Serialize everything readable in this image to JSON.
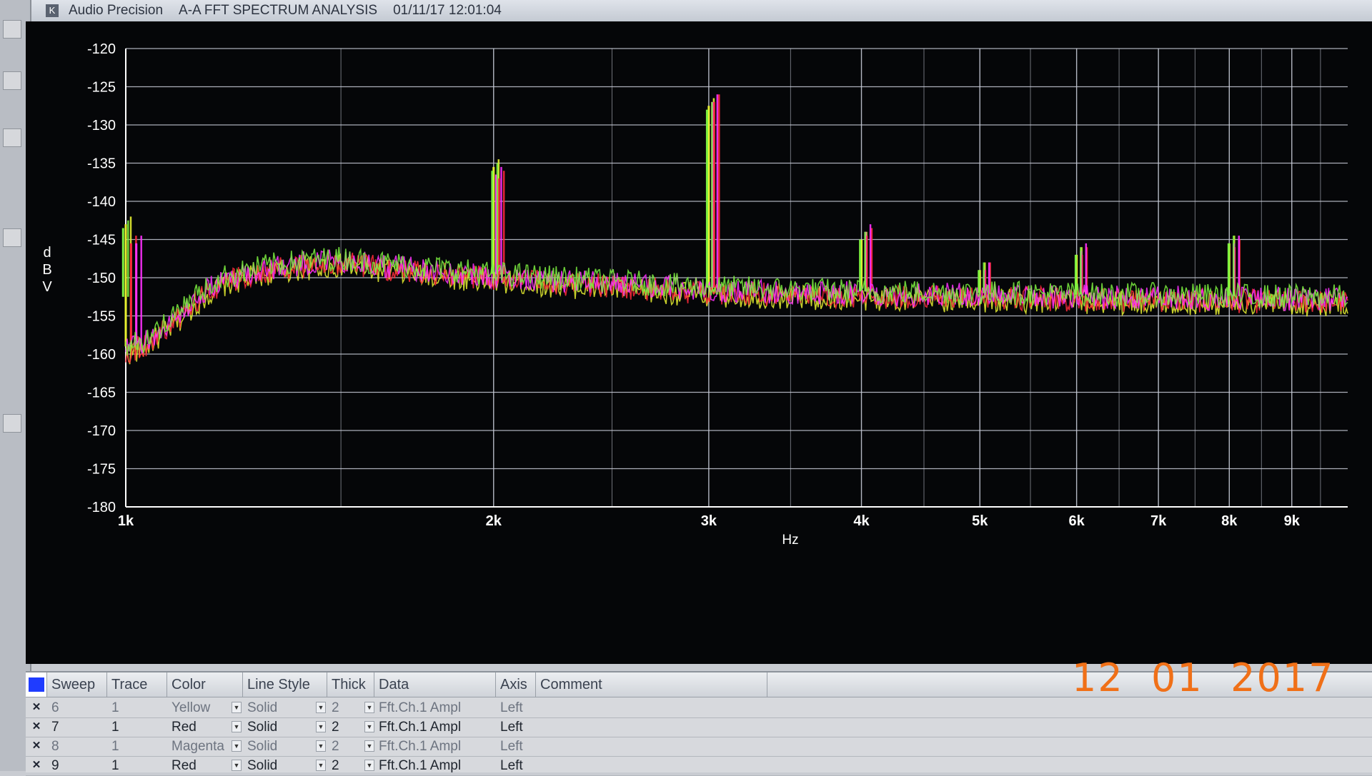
{
  "window": {
    "app_name": "Audio Precision",
    "graph_title": "A-A FFT SPECTRUM ANALYSIS",
    "timestamp": "01/11/17 12:01:04",
    "app_icon": "audio-precision-logo-icon"
  },
  "chart_data": {
    "type": "line",
    "ylabel": "d\nB\nV",
    "xlabel": "Hz",
    "xscale": "log",
    "xlim": [
      1000,
      10000
    ],
    "ylim": [
      -180,
      -120
    ],
    "y_ticks": [
      -120,
      -125,
      -130,
      -135,
      -140,
      -145,
      -150,
      -155,
      -160,
      -165,
      -170,
      -175,
      -180
    ],
    "x_ticks": [
      {
        "value": 1000,
        "label": "1k"
      },
      {
        "value": 2000,
        "label": "2k"
      },
      {
        "value": 3000,
        "label": "3k"
      },
      {
        "value": 4000,
        "label": "4k"
      },
      {
        "value": 5000,
        "label": "5k"
      },
      {
        "value": 6000,
        "label": "6k"
      },
      {
        "value": 7000,
        "label": "7k"
      },
      {
        "value": 8000,
        "label": "8k"
      },
      {
        "value": 9000,
        "label": "9k"
      }
    ],
    "grid": true,
    "background": "#050608",
    "noise_floor": {
      "x": [
        1000,
        1030,
        1060,
        1100,
        1150,
        1200,
        1300,
        1400,
        1500,
        1600,
        1800,
        2000,
        2500,
        3000,
        4000,
        5000,
        6000,
        7000,
        8000,
        9000,
        10000
      ],
      "y": [
        -160,
        -159.5,
        -158,
        -156,
        -153,
        -151,
        -149.5,
        -148.8,
        -148.5,
        -149,
        -149.8,
        -150.5,
        -151.5,
        -152.3,
        -152.8,
        -153,
        -153.2,
        -153.3,
        -153.4,
        -153.5,
        -153.5
      ]
    },
    "series": [
      {
        "name": "Yellow",
        "color": "#e8f030",
        "peaks": [
          {
            "x": 1000,
            "y": -143
          },
          {
            "x": 2000,
            "y": -135.5
          },
          {
            "x": 3000,
            "y": -127.5
          },
          {
            "x": 4000,
            "y": -145
          },
          {
            "x": 5000,
            "y": -149
          },
          {
            "x": 6000,
            "y": -147
          },
          {
            "x": 8000,
            "y": -145.5
          }
        ]
      },
      {
        "name": "Red",
        "color": "#ff2a3a",
        "peaks": [
          {
            "x": 1010,
            "y": -145.5
          },
          {
            "x": 2020,
            "y": -137
          },
          {
            "x": 3030,
            "y": -127
          },
          {
            "x": 4040,
            "y": -144.5
          },
          {
            "x": 5050,
            "y": -149
          },
          {
            "x": 6060,
            "y": -147
          },
          {
            "x": 8080,
            "y": -146
          }
        ]
      },
      {
        "name": "Magenta",
        "color": "#ff30ff",
        "peaks": [
          {
            "x": 1020,
            "y": -145.5
          },
          {
            "x": 2010,
            "y": -136.5
          },
          {
            "x": 3020,
            "y": -127
          },
          {
            "x": 4030,
            "y": -144
          },
          {
            "x": 5040,
            "y": -149
          },
          {
            "x": 6050,
            "y": -146.5
          },
          {
            "x": 8070,
            "y": -145.5
          }
        ]
      },
      {
        "name": "Green",
        "color": "#7cf040",
        "peaks": [
          {
            "x": 995,
            "y": -143.5
          },
          {
            "x": 1995,
            "y": -136
          },
          {
            "x": 2990,
            "y": -128
          },
          {
            "x": 3990,
            "y": -145
          },
          {
            "x": 4990,
            "y": -149
          },
          {
            "x": 5990,
            "y": -147
          },
          {
            "x": 7990,
            "y": -145.5
          }
        ]
      }
    ]
  },
  "legend": {
    "columns": [
      "Sweep",
      "Trace",
      "Color",
      "Line Style",
      "Thick",
      "Data",
      "Axis",
      "Comment"
    ],
    "rows": [
      {
        "sweep": "6",
        "trace": "1",
        "color": "Yellow",
        "line_style": "Solid",
        "thick": "2",
        "data": "Fft.Ch.1 Ampl",
        "axis": "Left",
        "comment": "",
        "strong": false
      },
      {
        "sweep": "7",
        "trace": "1",
        "color": "Red",
        "line_style": "Solid",
        "thick": "2",
        "data": "Fft.Ch.1 Ampl",
        "axis": "Left",
        "comment": "",
        "strong": true
      },
      {
        "sweep": "8",
        "trace": "1",
        "color": "Magenta",
        "line_style": "Solid",
        "thick": "2",
        "data": "Fft.Ch.1 Ampl",
        "axis": "Left",
        "comment": "",
        "strong": false
      },
      {
        "sweep": "9",
        "trace": "1",
        "color": "Red",
        "line_style": "Solid",
        "thick": "2",
        "data": "Fft.Ch.1 Ampl",
        "axis": "Left",
        "comment": "",
        "strong": true
      }
    ],
    "selected_color": "#1f3cff"
  },
  "date_stamp": "12  01  2017",
  "colors": {
    "grid": "#c8ccd8",
    "axis_text": "#ffffff",
    "stamp": "#f07018"
  }
}
